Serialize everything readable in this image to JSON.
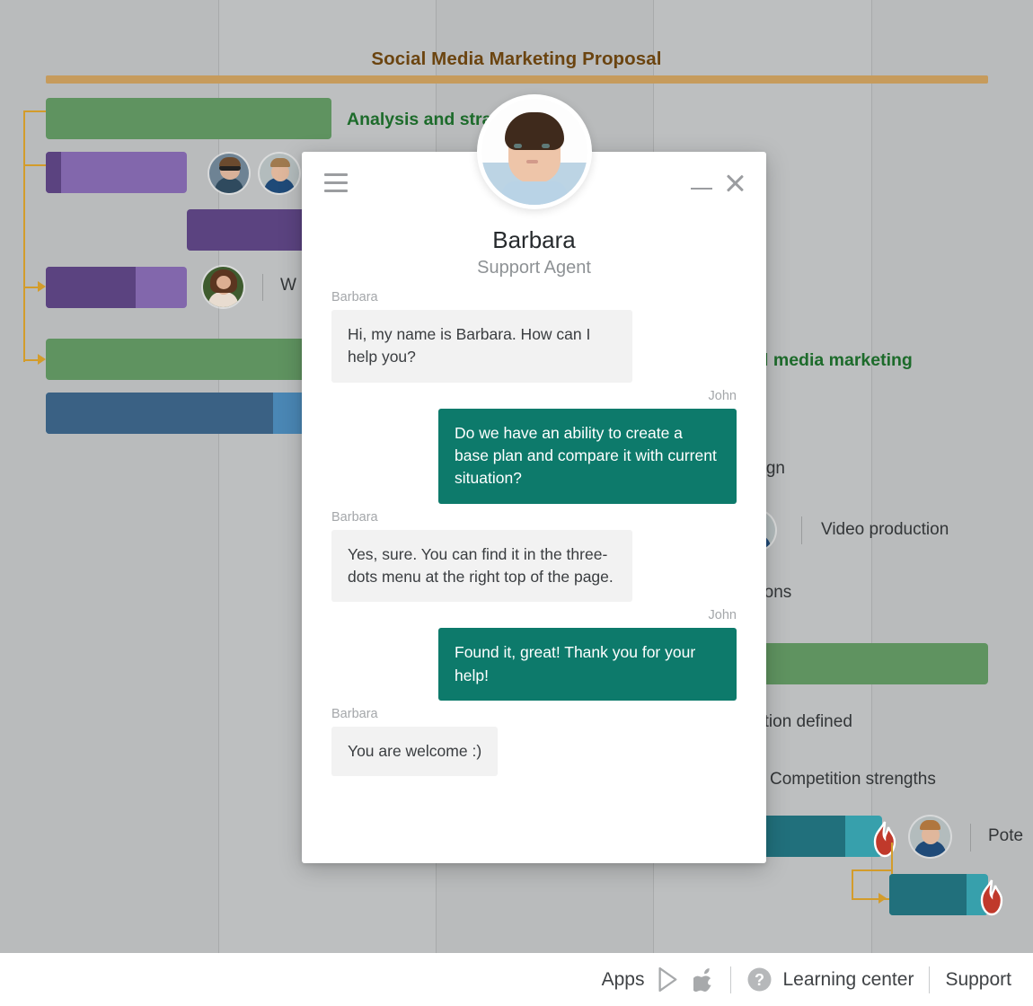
{
  "gantt": {
    "title": "Social Media Marketing Proposal",
    "summary_bar_color": "#c69b5c",
    "grid_line_color": "#a8aaab",
    "background_color": "#b9bbbc",
    "rows": [
      {
        "label": "Analysis and strategy",
        "label_color": "#1d6b2b",
        "bar_color": "#5f9360",
        "progress_color": "#5f9360",
        "bold": true
      },
      {
        "label": "",
        "bar_color": "#8267ac",
        "progress_color": "#5b4380"
      },
      {
        "label": "",
        "bar_color": "#5b4380",
        "progress_color": "#5b4380"
      },
      {
        "label": "W",
        "bar_color": "#8267ac",
        "progress_color": "#5b4380"
      },
      {
        "label": "Social media marketing",
        "label_color": "#1d6b2b",
        "bar_color": "#5f9360",
        "progress_color": "#5f9360",
        "bold": true
      },
      {
        "label": "",
        "bar_color": "#4a87b5",
        "progress_color": "#3a6184"
      },
      {
        "label": "design",
        "label_color": "#333638",
        "bar_color": "",
        "progress_color": ""
      },
      {
        "label": "Video production",
        "label_color": "#333638",
        "bar_color": "",
        "progress_color": ""
      },
      {
        "label": "notions",
        "label_color": "#333638",
        "bar_color": "",
        "progress_color": ""
      },
      {
        "label": "",
        "bar_color": "#5f9360",
        "progress_color": "#5f9360"
      },
      {
        "label": "petition defined",
        "label_color": "#333638",
        "bar_color": "",
        "progress_color": ""
      },
      {
        "label": "Competition strengths",
        "label_color": "#333638",
        "bar_color": "",
        "progress_color": ""
      },
      {
        "label": "Pote",
        "label_color": "#333638",
        "bar_color": "#37a0ac",
        "progress_color": "#21707c"
      },
      {
        "label": "",
        "bar_color": "#37a0ac",
        "progress_color": "#21707c"
      }
    ],
    "link_color": "#d39c2b"
  },
  "chat": {
    "agent_name": "Barbara",
    "agent_role": "Support Agent",
    "menu_icon": "hamburger-icon",
    "minimize_icon": "minimize-icon",
    "close_icon": "close-icon",
    "accent_color": "#0d7a6b",
    "messages": [
      {
        "who": "Barbara",
        "side": "in",
        "text": "Hi, my name is Barbara. How can I help you?"
      },
      {
        "who": "John",
        "side": "out",
        "text": "Do we have an ability to create a base plan and compare it with current situation?"
      },
      {
        "who": "Barbara",
        "side": "in",
        "text": "Yes, sure. You can find it in the three-dots menu at the right top of the page."
      },
      {
        "who": "John",
        "side": "out",
        "text": "Found it, great! Thank you for your help!"
      },
      {
        "who": "Barbara",
        "side": "in",
        "text": "You are welcome :)",
        "short": true
      }
    ]
  },
  "footer": {
    "apps_label": "Apps",
    "google_play_icon": "google-play-icon",
    "apple_icon": "apple-icon",
    "help_icon": "question-mark-icon",
    "learning_center_label": "Learning center",
    "support_label": "Support"
  }
}
